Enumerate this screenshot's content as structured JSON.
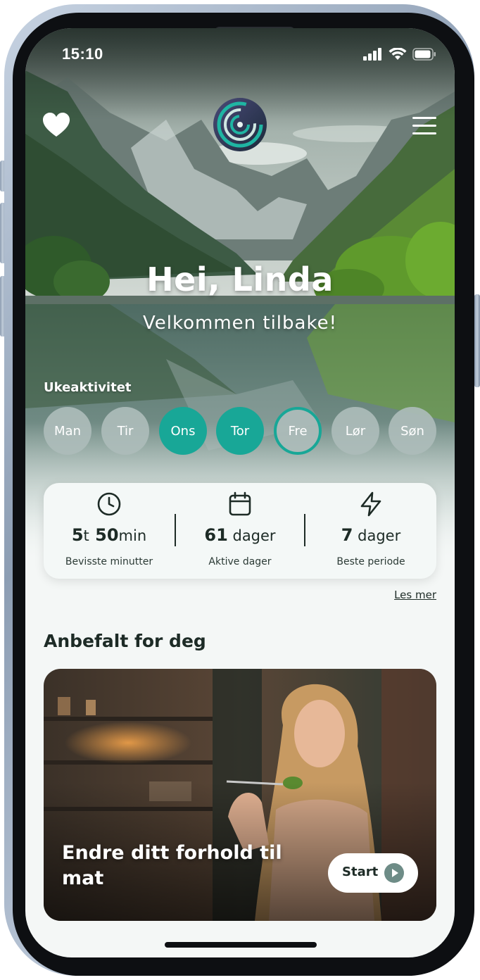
{
  "status_bar": {
    "time": "15:10"
  },
  "header": {
    "favorites_icon": "heart-icon",
    "logo": "app-logo",
    "menu_icon": "hamburger-menu-icon",
    "greeting": "Hei, Linda",
    "welcome": "Velkommen tilbake!"
  },
  "week_activity": {
    "label": "Ukeaktivitet",
    "days": [
      {
        "label": "Man",
        "state": "inactive"
      },
      {
        "label": "Tir",
        "state": "inactive"
      },
      {
        "label": "Ons",
        "state": "active"
      },
      {
        "label": "Tor",
        "state": "active"
      },
      {
        "label": "Fre",
        "state": "today"
      },
      {
        "label": "Lør",
        "state": "inactive"
      },
      {
        "label": "Søn",
        "state": "inactive"
      }
    ]
  },
  "stats": [
    {
      "icon": "clock-icon",
      "value_parts": [
        "5",
        "t",
        " 50",
        "min"
      ],
      "label": "Bevisste minutter"
    },
    {
      "icon": "calendar-icon",
      "value_parts": [
        "61",
        " dager"
      ],
      "label": "Aktive dager"
    },
    {
      "icon": "lightning-icon",
      "value_parts": [
        "7",
        " dager"
      ],
      "label": "Beste periode"
    }
  ],
  "read_more": "Les mer",
  "recommended": {
    "section_title": "Anbefalt for deg",
    "card_title": "Endre ditt forhold til mat",
    "start_label": "Start"
  },
  "colors": {
    "accent": "#18a797",
    "text_dark": "#1d2b26",
    "day_inactive": "#adbcba",
    "background": "#f4f7f6"
  }
}
